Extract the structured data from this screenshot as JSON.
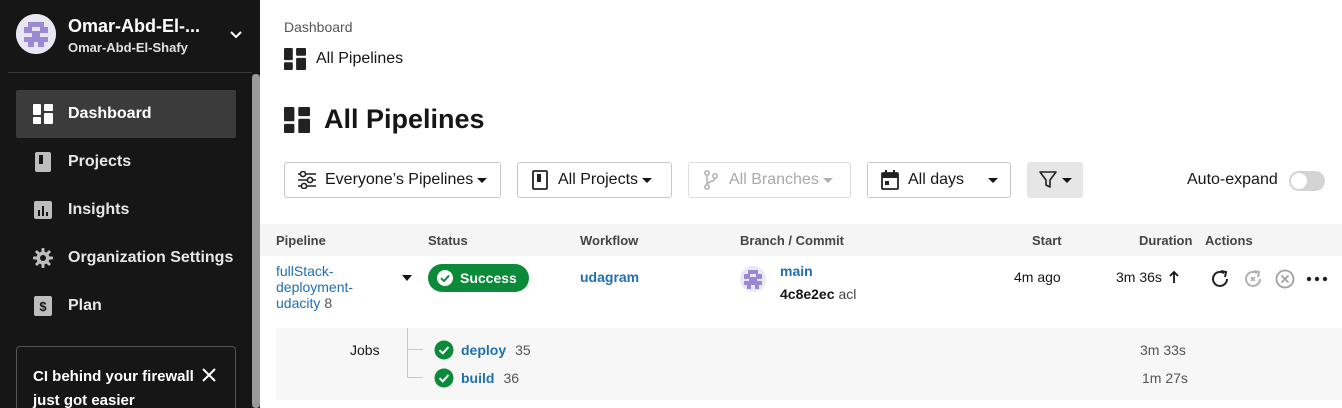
{
  "org": {
    "name": "Omar-Abd-El-...",
    "subname": "Omar-Abd-El-Shafy"
  },
  "nav": {
    "items": [
      {
        "label": "Dashboard",
        "icon": "dashboard-icon",
        "active": true
      },
      {
        "label": "Projects",
        "icon": "projects-icon"
      },
      {
        "label": "Insights",
        "icon": "insights-icon"
      },
      {
        "label": "Organization Settings",
        "icon": "gear-icon"
      },
      {
        "label": "Plan",
        "icon": "plan-icon"
      }
    ]
  },
  "promo": {
    "text": "CI behind your firewall just got easier"
  },
  "breadcrumb": "Dashboard",
  "subtitle": "All Pipelines",
  "title": "All Pipelines",
  "filters": {
    "pipelines": "Everyone’s Pipelines",
    "projects": "All Projects",
    "branches": "All Branches",
    "days": "All days",
    "auto_expand_label": "Auto-expand"
  },
  "table": {
    "headers": {
      "pipeline": "Pipeline",
      "status": "Status",
      "workflow": "Workflow",
      "branch_commit": "Branch / Commit",
      "start": "Start",
      "duration": "Duration",
      "actions": "Actions"
    },
    "row": {
      "pipeline_line1": "fullStack-",
      "pipeline_line2": "deployment-",
      "pipeline_line3": "udacity",
      "pipeline_number": "8",
      "status": "Success",
      "workflow": "udagram",
      "branch": "main",
      "commit_hash": "4c8e2ec",
      "commit_message": "acl",
      "start": "4m ago",
      "duration": "3m 36s"
    },
    "jobs_label": "Jobs",
    "jobs": [
      {
        "name": "deploy",
        "number": "35",
        "duration": "3m 33s"
      },
      {
        "name": "build",
        "number": "36",
        "duration": "1m 27s"
      }
    ]
  },
  "colors": {
    "sidebar_bg": "#161616",
    "success": "#0b8a3a",
    "link": "#1f6fb4"
  }
}
